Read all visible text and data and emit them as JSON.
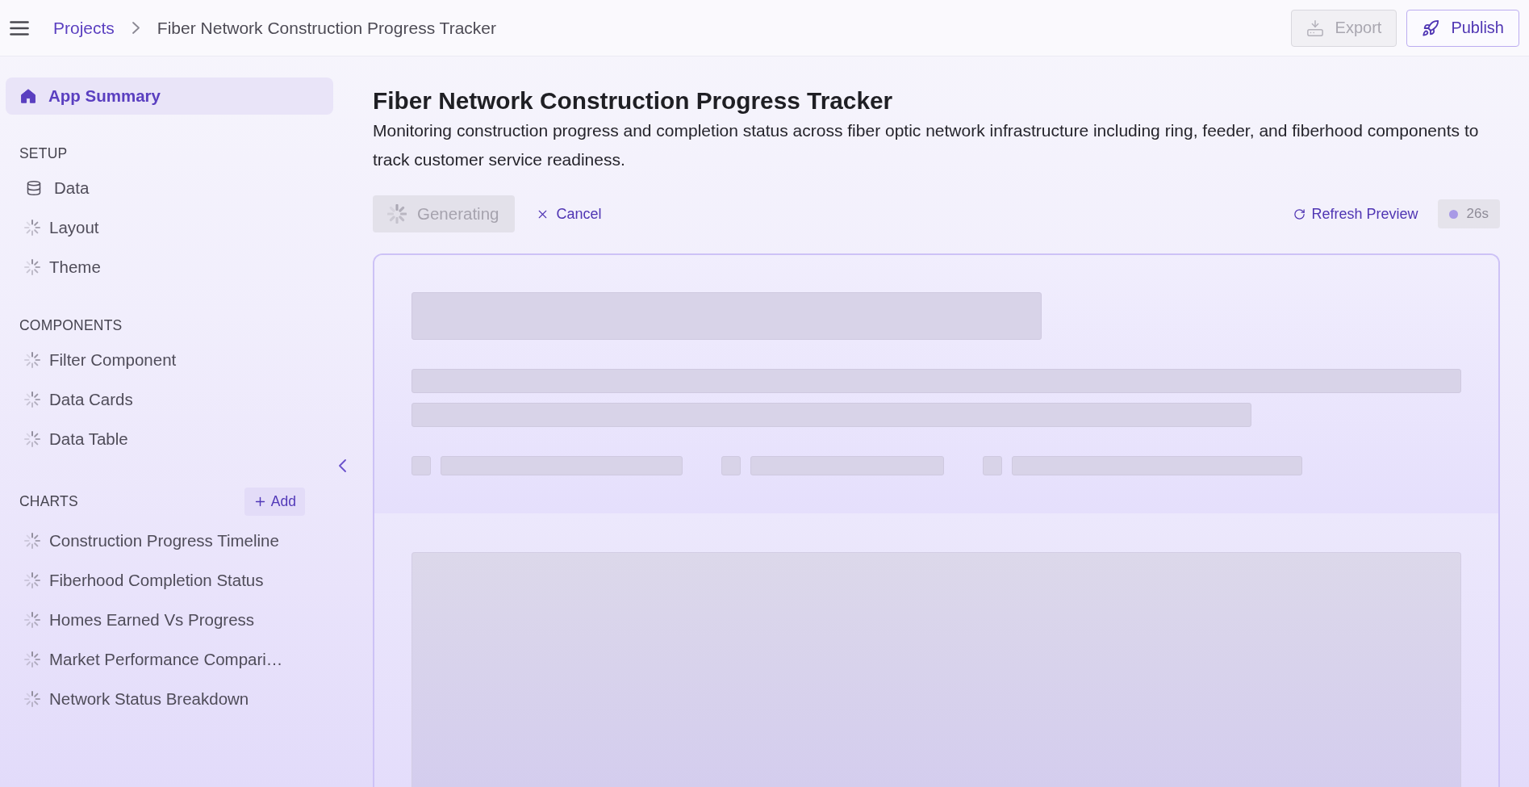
{
  "top_bar": {
    "breadcrumb": [
      {
        "label": "Projects",
        "kind": "link"
      },
      {
        "label": "Fiber Network Construction Progress Tracker",
        "kind": "current"
      }
    ],
    "actions": [
      {
        "label": "Export",
        "kind": "export",
        "disabled": true
      },
      {
        "label": "Publish",
        "kind": "publish",
        "disabled": false
      }
    ]
  },
  "sidebar": {
    "home": {
      "label": "App Summary",
      "selected": true
    },
    "sections": [
      {
        "title": "SETUP",
        "items": [
          {
            "label": "Data",
            "loading": false,
            "selected": false
          },
          {
            "label": "Layout",
            "loading": true,
            "selected": false
          },
          {
            "label": "Theme",
            "loading": true,
            "selected": false
          }
        ]
      },
      {
        "title": "COMPONENTS",
        "items": [
          {
            "label": "Filter Component",
            "loading": true,
            "selected": false
          },
          {
            "label": "Data Cards",
            "loading": true,
            "selected": false
          },
          {
            "label": "Data Table",
            "loading": true,
            "selected": false
          }
        ]
      },
      {
        "title": "CHARTS",
        "action": "Add",
        "items": [
          {
            "label": "Construction Progress Timeline",
            "loading": true,
            "selected": false
          },
          {
            "label": "Fiberhood Completion Status",
            "loading": true,
            "selected": false
          },
          {
            "label": "Homes Earned Vs Progress",
            "loading": true,
            "selected": false
          },
          {
            "label": "Market Performance Compari…",
            "loading": true,
            "selected": false
          },
          {
            "label": "Network Status Breakdown",
            "loading": true,
            "selected": false
          }
        ]
      }
    ]
  },
  "page_header": {
    "title": "Fiber Network Construction Progress Tracker",
    "description": "Monitoring construction progress and completion status across fiber optic network infrastructure including ring, feeder, and fiberhood components to track customer service readiness."
  },
  "toolbar": {
    "generate_button": {
      "label": "Generating",
      "disabled": true,
      "loading": true
    },
    "cancel_button": {
      "label": "Cancel"
    },
    "refresh_button": {
      "label": "Refresh Preview"
    },
    "timer": "26s"
  }
}
